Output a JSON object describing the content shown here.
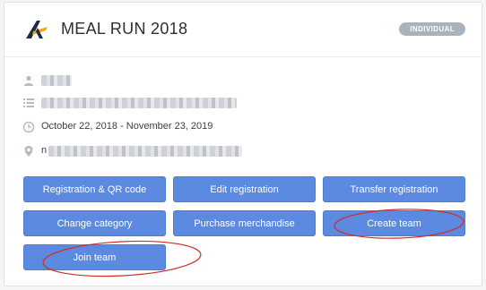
{
  "header": {
    "title": "MEAL RUN 2018",
    "badge": "INDIVIDUAL"
  },
  "info": {
    "date_range": "October 22, 2018 - November 23, 2019",
    "location_prefix": "n"
  },
  "buttons": {
    "registration_qr": "Registration & QR code",
    "edit_registration": "Edit registration",
    "transfer_registration": "Transfer registration",
    "change_category": "Change category",
    "purchase_merchandise": "Purchase merchandise",
    "create_team": "Create team",
    "join_team": "Join team"
  },
  "colors": {
    "button_bg": "#5b8ae0",
    "annotation": "#d42a2a",
    "logo_blue": "#1f2a44",
    "logo_accent": "#f2a20c"
  }
}
